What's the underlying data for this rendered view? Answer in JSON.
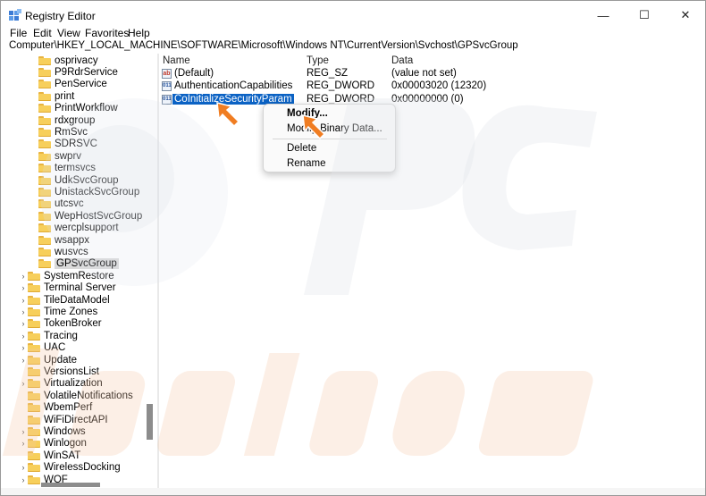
{
  "window": {
    "title": "Registry Editor",
    "controls": {
      "minimize": "—",
      "maximize": "☐",
      "close": "✕"
    }
  },
  "menu": [
    "File",
    "Edit",
    "View",
    "Favorites",
    "Help"
  ],
  "address": "Computer\\HKEY_LOCAL_MACHINE\\SOFTWARE\\Microsoft\\Windows NT\\CurrentVersion\\Svchost\\GPSvcGroup",
  "tree": {
    "nested": [
      "osprivacy",
      "P9RdrService",
      "PenService",
      "print",
      "PrintWorkflow",
      "rdxgroup",
      "RmSvc",
      "SDRSVC",
      "swprv",
      "termsvcs",
      "UdkSvcGroup",
      "UnistackSvcGroup",
      "utcsvc",
      "WepHostSvcGroup",
      "wercplsupport",
      "wsappx",
      "wusvcs",
      "GPSvcGroup"
    ],
    "selected": "GPSvcGroup",
    "siblings": [
      {
        "label": "SystemRestore",
        "expandable": true
      },
      {
        "label": "Terminal Server",
        "expandable": true
      },
      {
        "label": "TileDataModel",
        "expandable": true
      },
      {
        "label": "Time Zones",
        "expandable": true
      },
      {
        "label": "TokenBroker",
        "expandable": true
      },
      {
        "label": "Tracing",
        "expandable": true
      },
      {
        "label": "UAC",
        "expandable": true
      },
      {
        "label": "Update",
        "expandable": true
      },
      {
        "label": "VersionsList",
        "expandable": false
      },
      {
        "label": "Virtualization",
        "expandable": true
      },
      {
        "label": "VolatileNotifications",
        "expandable": false
      },
      {
        "label": "WbemPerf",
        "expandable": false
      },
      {
        "label": "WiFiDirectAPI",
        "expandable": false
      },
      {
        "label": "Windows",
        "expandable": true
      },
      {
        "label": "Winlogon",
        "expandable": true
      },
      {
        "label": "WinSAT",
        "expandable": false
      },
      {
        "label": "WirelessDocking",
        "expandable": true
      },
      {
        "label": "WOF",
        "expandable": true
      }
    ]
  },
  "list": {
    "columns": [
      "Name",
      "Type",
      "Data"
    ],
    "rows": [
      {
        "icon": "string-value-icon",
        "glyph": "ab",
        "name": "(Default)",
        "type": "REG_SZ",
        "data": "(value not set)",
        "selected": false
      },
      {
        "icon": "binary-value-icon",
        "glyph": "011",
        "name": "AuthenticationCapabilities",
        "type": "REG_DWORD",
        "data": "0x00003020 (12320)",
        "selected": false
      },
      {
        "icon": "binary-value-icon",
        "glyph": "011",
        "name": "CoInitializeSecurityParam",
        "type": "REG_DWORD",
        "data": "0x00000000 (0)",
        "selected": true
      }
    ]
  },
  "context_menu": {
    "items": [
      "Modify...",
      "Modify Binary Data...",
      "Delete",
      "Rename"
    ]
  },
  "colors": {
    "selection": "#0b62c4",
    "pointer_arrow": "#f07d22",
    "folder": "#f7cf5b"
  }
}
